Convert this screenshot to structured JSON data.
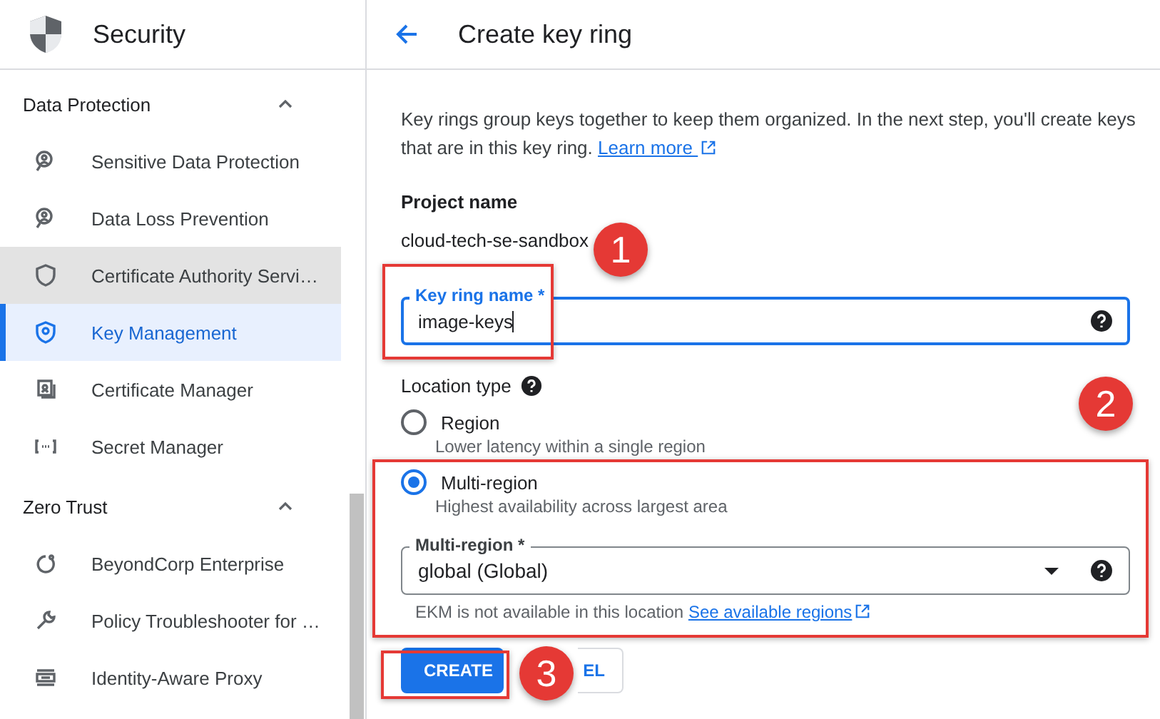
{
  "sidebar": {
    "title": "Security",
    "sections": [
      {
        "label": "Data Protection",
        "expanded": true,
        "items": [
          {
            "label": "Sensitive Data Protection",
            "selected": false,
            "highlighted": false
          },
          {
            "label": "Data Loss Prevention",
            "selected": false,
            "highlighted": false
          },
          {
            "label": "Certificate Authority Servi…",
            "selected": false,
            "highlighted": true
          },
          {
            "label": "Key Management",
            "selected": true,
            "highlighted": false
          },
          {
            "label": "Certificate Manager",
            "selected": false,
            "highlighted": false
          },
          {
            "label": "Secret Manager",
            "selected": false,
            "highlighted": false
          }
        ]
      },
      {
        "label": "Zero Trust",
        "expanded": true,
        "items": [
          {
            "label": "BeyondCorp Enterprise",
            "selected": false,
            "highlighted": false
          },
          {
            "label": "Policy Troubleshooter for …",
            "selected": false,
            "highlighted": false
          },
          {
            "label": "Identity-Aware Proxy",
            "selected": false,
            "highlighted": false
          }
        ]
      }
    ]
  },
  "page": {
    "title": "Create key ring",
    "intro": "Key rings group keys together to keep them organized. In the next step, you'll create keys that are in this key ring.",
    "learn_more": "Learn more",
    "project_label": "Project name",
    "project_value": "cloud-tech-se-sandbox",
    "key_ring_field": {
      "label": "Key ring name *",
      "value": "image-keys"
    },
    "location_label": "Location type",
    "options": [
      {
        "label": "Region",
        "description": "Lower latency within a single region",
        "selected": false
      },
      {
        "label": "Multi-region",
        "description": "Highest availability across largest area",
        "selected": true
      }
    ],
    "multi_region_field": {
      "label": "Multi-region *",
      "value": "global (Global)"
    },
    "hint": "EKM is not available in this location",
    "hint_link": "See available regions",
    "buttons": [
      {
        "label": "CREATE",
        "kind": "primary"
      },
      {
        "label": "EL",
        "kind": "secondary"
      }
    ]
  },
  "annotations": [
    {
      "label": "1"
    },
    {
      "label": "2"
    },
    {
      "label": "3"
    }
  ]
}
